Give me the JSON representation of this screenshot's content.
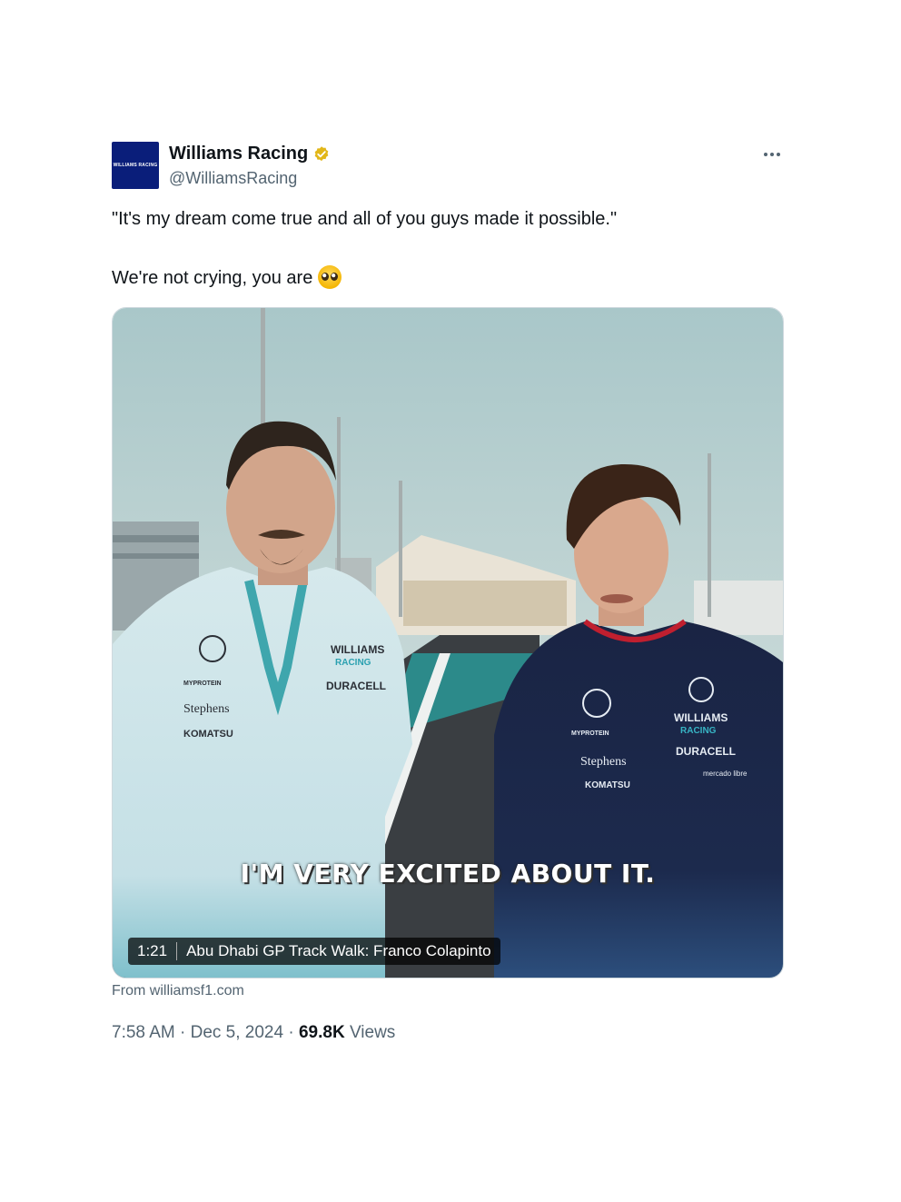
{
  "author": {
    "avatar_text": "WILLIAMS RACING",
    "display_name": "Williams Racing",
    "handle": "@WilliamsRacing",
    "verified_badge": "gold-verified-badge-icon"
  },
  "more_icon": "more-horizontal-icon",
  "tweet_text": {
    "line1": "\"It's my dream come true and all of you guys made it possible.\"",
    "line2": "We're not crying, you are",
    "emoji": "pleading-face-emoji"
  },
  "video": {
    "caption": "I'M VERY EXCITED ABOUT IT.",
    "duration": "1:21",
    "title": "Abu Dhabi GP Track Walk: Franco Colapinto",
    "shirt_left": [
      "WILLIAMS",
      "RACING",
      "DURACELL",
      "Stephens",
      "KOMATSU",
      "MYPROTEIN"
    ],
    "shirt_right": [
      "WILLIAMS",
      "RACING",
      "DURACELL",
      "Stephens",
      "KOMATSU",
      "MYPROTEIN",
      "mercado libre"
    ]
  },
  "source": "From williamsf1.com",
  "meta": {
    "time": "7:58 AM",
    "sep1": " · ",
    "date": "Dec 5, 2024",
    "sep2": " · ",
    "views_count": "69.8K",
    "views_label": " Views"
  },
  "colors": {
    "williams_blue": "#0a1e7a",
    "badge_gold": "#e2b719",
    "secondary_text": "#536471"
  }
}
